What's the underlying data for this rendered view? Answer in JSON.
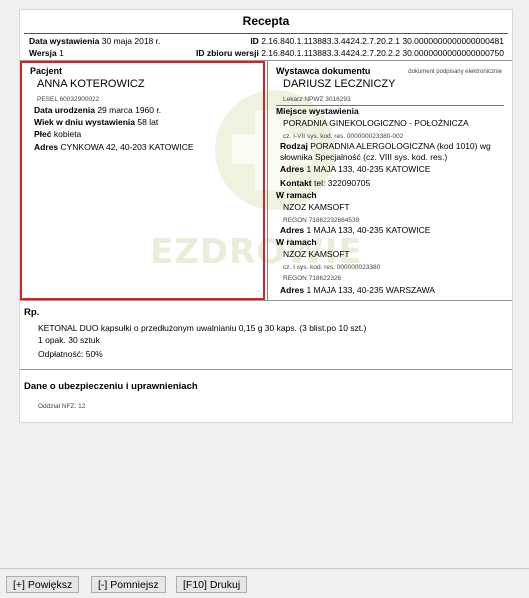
{
  "title": "Recepta",
  "header": {
    "issue_date_label": "Data wystawienia",
    "issue_date": "30 maja 2018 r.",
    "id_label": "ID",
    "id_value": "2.16.840.1.113883.3.4424.2.7.20.2.1 30.0000000000000000481",
    "version_label": "Wersja",
    "version": "1",
    "set_id_label": "ID zbioru wersji",
    "set_id_value": "2.16.840.1.113883.3.4424.2.7.20.2.2 30.0000000000000000750"
  },
  "patient": {
    "heading": "Pacjent",
    "name": "ANNA KOTEROWICZ",
    "pesel": "PESEL 60032900022",
    "birth_label": "Data urodzenia",
    "birth_value": "29 marca 1960 r.",
    "age_label": "Wiek w dniu wystawienia",
    "age_value": "58 lat",
    "sex_label": "Płeć",
    "sex_value": "kobieta",
    "address_label": "Adres",
    "address_value": "CYNKOWA 42, 40-203 KATOWICE"
  },
  "issuer": {
    "heading": "Wystawca dokumentu",
    "signed_note": "dokument podpisany elektronicznie",
    "name": "DARIUSZ LECZNICZY",
    "npwz": "Lekarz NPWZ 3016293",
    "place_heading": "Miejsce wystawienia",
    "place_name": "PORADNIA GINEKOLOGICZNO - POŁOŻNICZA",
    "place_code": "cz. I-VII sys. kod. res. 000000023380-002",
    "kind_label": "Rodzaj",
    "kind_value_1": "PORADNIA ALERGOLOGICZNA (kod 1010) wg",
    "kind_value_2": "słownika Specjalność (cz. VIII sys. kod. res.)",
    "address_label": "Adres",
    "place_address": "1 MAJA 133, 40-235 KATOWICE",
    "contact_label": "Kontakt",
    "contact_value": "tel: 322090705",
    "within_label": "W ramach",
    "org1_name": "NZOZ KAMSOFT",
    "org1_regon": "REGON 71862232664539",
    "org1_address": "1 MAJA 133, 40-235 KATOWICE",
    "org2_name": "NZOZ KAMSOFT",
    "org2_code": "cz. I sys. kod. res. 000000023380",
    "org2_regon": "REGON 718622326",
    "org2_address": "1 MAJA 133, 40-235 WARSZAWA"
  },
  "watermark": "EZDROWIE",
  "rp": {
    "heading": "Rp.",
    "drug": "KETONAL DUO kapsułki o przedłużonym uwalnianiu 0,15 g 30 kaps. (3 blist.po 10 szt.)",
    "quantity": "1 opak. 30 sztuk",
    "payment": "Odpłatność: 50%"
  },
  "insurance": {
    "heading": "Dane o ubezpieczeniu i uprawnieniach",
    "nfz": "Oddział NFZ: 12"
  },
  "buttons": {
    "zoom_in": "[+] Powiększ",
    "zoom_out": "[-] Pomniejsz",
    "print": "[F10] Drukuj"
  },
  "colors": {
    "highlight_border": "#d9202a",
    "watermark": "#e8efd8"
  }
}
